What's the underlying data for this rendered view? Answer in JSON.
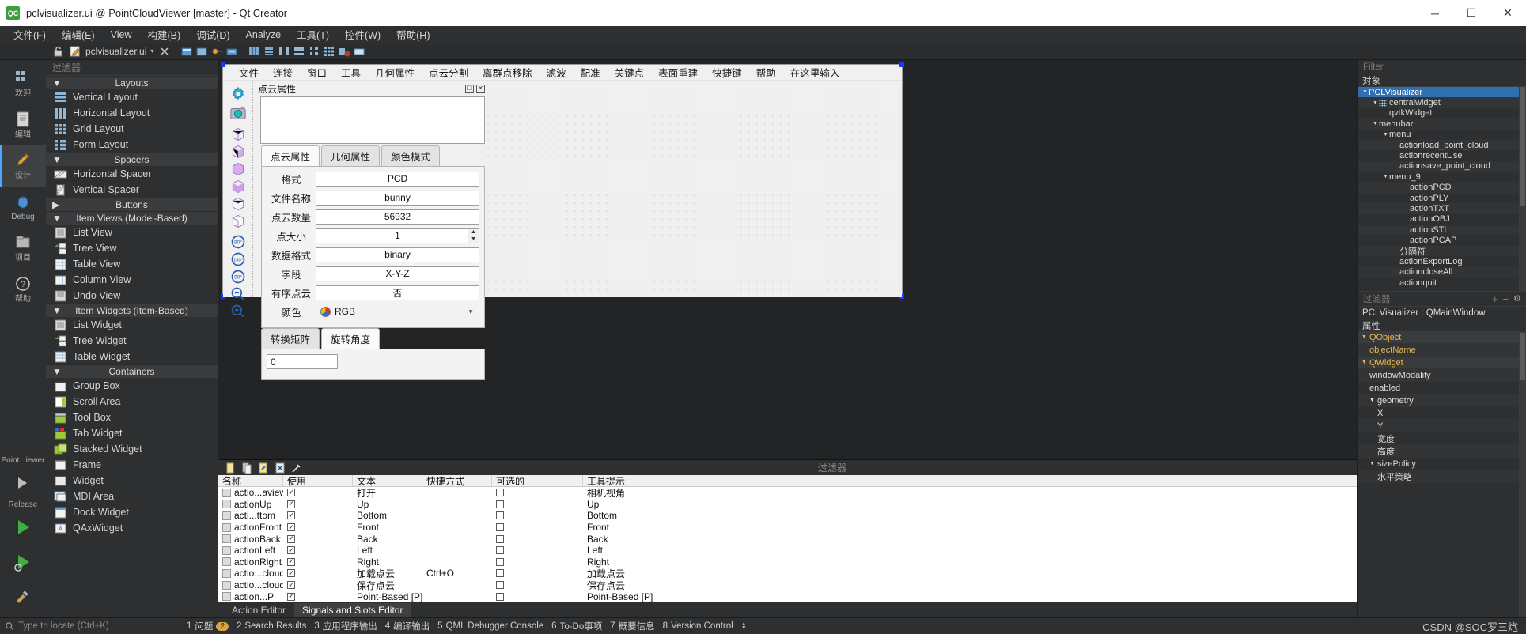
{
  "window": {
    "title": "pclvisualizer.ui @ PointCloudViewer [master] - Qt Creator",
    "logo_text": "QC",
    "minimize": "─",
    "maximize": "☐",
    "close": "✕"
  },
  "menubar": [
    "文件(F)",
    "编辑(E)",
    "View",
    "构建(B)",
    "调试(D)",
    "Analyze",
    "工具(T)",
    "控件(W)",
    "帮助(H)"
  ],
  "toolbar": {
    "file_label": "pclvisualizer.ui"
  },
  "rail": {
    "items": [
      {
        "label": "欢迎",
        "icon": "grid-icon"
      },
      {
        "label": "编辑",
        "icon": "document-icon"
      },
      {
        "label": "设计",
        "icon": "design-icon"
      },
      {
        "label": "Debug",
        "icon": "debug-icon"
      },
      {
        "label": "项目",
        "icon": "projects-icon"
      },
      {
        "label": "帮助",
        "icon": "help-icon"
      }
    ],
    "kit_label": "Point...iewer",
    "build_label": "Release"
  },
  "widgetbox": {
    "filter_placeholder": "过滤器",
    "groups": [
      {
        "title": "Layouts",
        "expanded": true,
        "items": [
          "Vertical Layout",
          "Horizontal Layout",
          "Grid Layout",
          "Form Layout"
        ]
      },
      {
        "title": "Spacers",
        "expanded": true,
        "items": [
          "Horizontal Spacer",
          "Vertical Spacer"
        ]
      },
      {
        "title": "Buttons",
        "expanded": false,
        "items": []
      },
      {
        "title": "Item Views (Model-Based)",
        "expanded": true,
        "items": [
          "List View",
          "Tree View",
          "Table View",
          "Column View",
          "Undo View"
        ]
      },
      {
        "title": "Item Widgets (Item-Based)",
        "expanded": true,
        "items": [
          "List Widget",
          "Tree Widget",
          "Table Widget"
        ]
      },
      {
        "title": "Containers",
        "expanded": true,
        "items": [
          "Group Box",
          "Scroll Area",
          "Tool Box",
          "Tab Widget",
          "Stacked Widget",
          "Frame",
          "Widget",
          "MDI Area",
          "Dock Widget",
          "QAxWidget"
        ]
      }
    ]
  },
  "form": {
    "menu_items": [
      "文件",
      "连接",
      "窗口",
      "工具",
      "几何属性",
      "点云分割",
      "离群点移除",
      "滤波",
      "配准",
      "关键点",
      "表面重建",
      "快捷键",
      "帮助",
      "在这里输入"
    ],
    "dock_title": "点云属性",
    "dock_float_icon": "float-icon",
    "dock_close_icon": "close-icon",
    "tabs": [
      "点云属性",
      "几何属性",
      "颜色模式"
    ],
    "active_tab": "点云属性",
    "fields": [
      {
        "label": "格式",
        "value": "PCD",
        "type": "text"
      },
      {
        "label": "文件名称",
        "value": "bunny",
        "type": "text"
      },
      {
        "label": "点云数量",
        "value": "56932",
        "type": "text"
      },
      {
        "label": "点大小",
        "value": "1",
        "type": "spin"
      },
      {
        "label": "数据格式",
        "value": "binary",
        "type": "text"
      },
      {
        "label": "字段",
        "value": "X-Y-Z",
        "type": "text"
      },
      {
        "label": "有序点云",
        "value": "否",
        "type": "text"
      },
      {
        "label": "颜色",
        "value": "RGB",
        "type": "combo"
      }
    ],
    "subtabs": [
      "转换矩阵",
      "旋转角度"
    ],
    "active_subtab": "旋转角度",
    "subtab_value": "0"
  },
  "action_editor": {
    "filter_placeholder": "过滤器",
    "tools": [
      "new-action-icon",
      "copy-action-icon",
      "edit-action-icon",
      "delete-action-icon",
      "configure-icon"
    ],
    "columns": [
      "名称",
      "使用",
      "文本",
      "快捷方式",
      "可选的",
      "工具提示"
    ],
    "rows": [
      {
        "name": "actio...aview",
        "used": true,
        "text": "打开",
        "shortcut": "",
        "checkable": false,
        "tooltip": "相机视角"
      },
      {
        "name": "actionUp",
        "used": true,
        "text": "Up",
        "shortcut": "",
        "checkable": false,
        "tooltip": "Up"
      },
      {
        "name": "acti...ttom",
        "used": true,
        "text": "Bottom",
        "shortcut": "",
        "checkable": false,
        "tooltip": "Bottom"
      },
      {
        "name": "actionFront",
        "used": true,
        "text": "Front",
        "shortcut": "",
        "checkable": false,
        "tooltip": "Front"
      },
      {
        "name": "actionBack",
        "used": true,
        "text": "Back",
        "shortcut": "",
        "checkable": false,
        "tooltip": "Back"
      },
      {
        "name": "actionLeft",
        "used": true,
        "text": "Left",
        "shortcut": "",
        "checkable": false,
        "tooltip": "Left"
      },
      {
        "name": "actionRight",
        "used": true,
        "text": "Right",
        "shortcut": "",
        "checkable": false,
        "tooltip": "Right"
      },
      {
        "name": "actio...cloud",
        "used": true,
        "text": "加载点云",
        "shortcut": "Ctrl+O",
        "checkable": false,
        "tooltip": "加载点云"
      },
      {
        "name": "actio...cloud",
        "used": true,
        "text": "保存点云",
        "shortcut": "",
        "checkable": false,
        "tooltip": "保存点云"
      },
      {
        "name": "action...P",
        "used": true,
        "text": "Point-Based [P]",
        "shortcut": "",
        "checkable": false,
        "tooltip": "Point-Based [P]"
      }
    ],
    "tabs": [
      "Action Editor",
      "Signals and Slots Editor"
    ],
    "active_tab": "Signals and Slots Editor"
  },
  "right_panel": {
    "filter_placeholder": "Filter",
    "object_header": "对象",
    "tree": [
      {
        "label": "PCLVisualizer",
        "depth": 0,
        "arrow": "▼",
        "selected": true,
        "icon": ""
      },
      {
        "label": "centralwidget",
        "depth": 1,
        "arrow": "▼",
        "selected": false,
        "icon": "grid-icon"
      },
      {
        "label": "qvtkWidget",
        "depth": 2,
        "arrow": "",
        "selected": false,
        "icon": ""
      },
      {
        "label": "menubar",
        "depth": 1,
        "arrow": "▼",
        "selected": false,
        "icon": ""
      },
      {
        "label": "menu",
        "depth": 2,
        "arrow": "▼",
        "selected": false,
        "icon": ""
      },
      {
        "label": "actionload_point_cloud",
        "depth": 3,
        "arrow": "",
        "selected": false,
        "icon": ""
      },
      {
        "label": "actionrecentUse",
        "depth": 3,
        "arrow": "",
        "selected": false,
        "icon": ""
      },
      {
        "label": "actionsave_point_cloud",
        "depth": 3,
        "arrow": "",
        "selected": false,
        "icon": ""
      },
      {
        "label": "menu_9",
        "depth": 2,
        "arrow": "▼",
        "selected": false,
        "icon": ""
      },
      {
        "label": "actionPCD",
        "depth": 4,
        "arrow": "",
        "selected": false,
        "icon": ""
      },
      {
        "label": "actionPLY",
        "depth": 4,
        "arrow": "",
        "selected": false,
        "icon": ""
      },
      {
        "label": "actionTXT",
        "depth": 4,
        "arrow": "",
        "selected": false,
        "icon": ""
      },
      {
        "label": "actionOBJ",
        "depth": 4,
        "arrow": "",
        "selected": false,
        "icon": ""
      },
      {
        "label": "actionSTL",
        "depth": 4,
        "arrow": "",
        "selected": false,
        "icon": ""
      },
      {
        "label": "actionPCAP",
        "depth": 4,
        "arrow": "",
        "selected": false,
        "icon": ""
      },
      {
        "label": "分隔符",
        "depth": 3,
        "arrow": "",
        "selected": false,
        "icon": ""
      },
      {
        "label": "actionExportLog",
        "depth": 3,
        "arrow": "",
        "selected": false,
        "icon": ""
      },
      {
        "label": "actioncloseAll",
        "depth": 3,
        "arrow": "",
        "selected": false,
        "icon": ""
      },
      {
        "label": "actionquit",
        "depth": 3,
        "arrow": "",
        "selected": false,
        "icon": ""
      }
    ],
    "prop_filter_placeholder": "过滤器",
    "object_name_line": "PCLVisualizer : QMainWindow",
    "properties_header": "属性",
    "properties": [
      {
        "key": "QObject",
        "value": "",
        "type": "category",
        "depth": 0
      },
      {
        "key": "objectName",
        "value": "",
        "type": "highlight",
        "depth": 1
      },
      {
        "key": "QWidget",
        "value": "",
        "type": "category",
        "depth": 0
      },
      {
        "key": "windowModality",
        "value": "",
        "type": "row",
        "depth": 1
      },
      {
        "key": "enabled",
        "value": "",
        "type": "row",
        "depth": 1
      },
      {
        "key": "geometry",
        "value": "",
        "type": "group",
        "depth": 1
      },
      {
        "key": "X",
        "value": "",
        "type": "row",
        "depth": 2
      },
      {
        "key": "Y",
        "value": "",
        "type": "row",
        "depth": 2
      },
      {
        "key": "宽度",
        "value": "",
        "type": "row",
        "depth": 2
      },
      {
        "key": "高度",
        "value": "",
        "type": "row",
        "depth": 2
      },
      {
        "key": "sizePolicy",
        "value": "",
        "type": "group",
        "depth": 1
      },
      {
        "key": "水平策略",
        "value": "",
        "type": "row",
        "depth": 2
      }
    ]
  },
  "statusbar": {
    "search_placeholder": "Type to locate (Ctrl+K)",
    "items": [
      {
        "num": "1",
        "label": "问题",
        "badge": "2"
      },
      {
        "num": "2",
        "label": "Search Results",
        "badge": ""
      },
      {
        "num": "3",
        "label": "应用程序输出",
        "badge": ""
      },
      {
        "num": "4",
        "label": "编译输出",
        "badge": ""
      },
      {
        "num": "5",
        "label": "QML Debugger Console",
        "badge": ""
      },
      {
        "num": "6",
        "label": "To-Do事项",
        "badge": ""
      },
      {
        "num": "7",
        "label": "概要信息",
        "badge": ""
      },
      {
        "num": "8",
        "label": "Version Control",
        "badge": ""
      }
    ],
    "watermark": "CSDN @SOC罗三炮"
  },
  "colors": {
    "accent": "#2f6fb2",
    "selection": "#1a39ff",
    "panel": "#2e2f30",
    "form_bg": "#f0f0f0",
    "highlight_key": "#e6b84e"
  }
}
